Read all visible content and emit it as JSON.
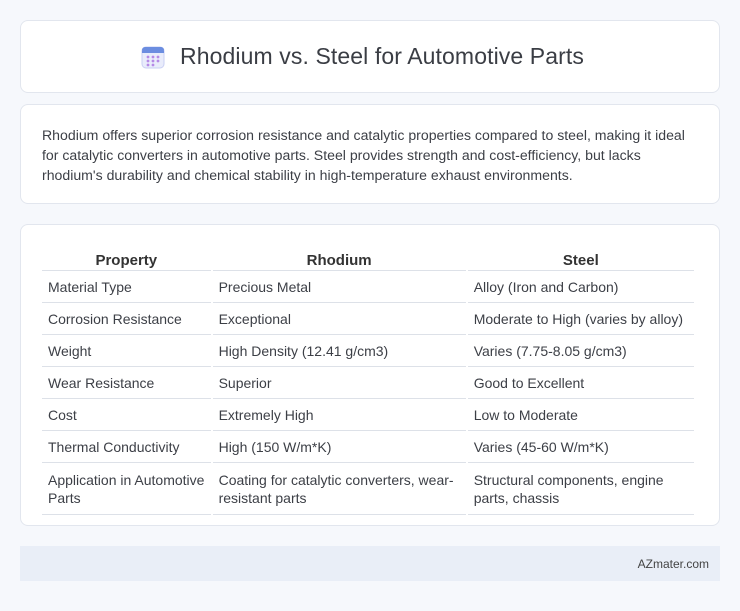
{
  "header": {
    "title": "Rhodium vs. Steel for Automotive Parts",
    "icon": "calendar-icon",
    "accent": "#6b8de0"
  },
  "description": {
    "text": "Rhodium offers superior corrosion resistance and catalytic properties compared to steel, making it ideal for catalytic converters in automotive parts. Steel provides strength and cost-efficiency, but lacks rhodium's durability and chemical stability in high-temperature exhaust environments."
  },
  "table": {
    "headers": [
      "Property",
      "Rhodium",
      "Steel"
    ],
    "rows": [
      [
        "Material Type",
        "Precious Metal",
        "Alloy (Iron and Carbon)"
      ],
      [
        "Corrosion Resistance",
        "Exceptional",
        "Moderate to High (varies by alloy)"
      ],
      [
        "Weight",
        "High Density (12.41 g/cm3)",
        "Varies (7.75-8.05 g/cm3)"
      ],
      [
        "Wear Resistance",
        "Superior",
        "Good to Excellent"
      ],
      [
        "Cost",
        "Extremely High",
        "Low to Moderate"
      ],
      [
        "Thermal Conductivity",
        "High (150 W/m*K)",
        "Varies (45-60 W/m*K)"
      ],
      [
        "Application in Automotive Parts",
        "Coating for catalytic converters, wear-resistant parts",
        "Structural components, engine parts, chassis"
      ]
    ]
  },
  "footer": {
    "text": "AZmater.com"
  }
}
